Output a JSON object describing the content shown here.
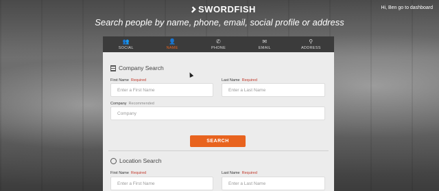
{
  "header": {
    "brand": "SWORDFISH",
    "user_link": "Hi, Ben go to dashboard",
    "headline": "Search people by name, phone, email, social profile or address"
  },
  "tabs": [
    {
      "label": "SOCIAL",
      "icon": "users-icon",
      "glyph": "👥",
      "active": false
    },
    {
      "label": "NAME",
      "icon": "person-icon",
      "glyph": "👤",
      "active": true
    },
    {
      "label": "PHONE",
      "icon": "phone-icon",
      "glyph": "✆",
      "active": false
    },
    {
      "label": "EMAIL",
      "icon": "envelope-icon",
      "glyph": "✉",
      "active": false
    },
    {
      "label": "ADDRESS",
      "icon": "map-pin-icon",
      "glyph": "⚲",
      "active": false
    }
  ],
  "company_search": {
    "title": "Company Search",
    "first_name": {
      "label": "First Name",
      "tag": "Required",
      "placeholder": "Enter a First Name",
      "value": ""
    },
    "last_name": {
      "label": "Last Name",
      "tag": "Required",
      "placeholder": "Enter a Last Name",
      "value": ""
    },
    "company": {
      "label": "Company",
      "tag": "Recommended",
      "placeholder": "Company",
      "value": ""
    },
    "submit_label": "SEARCH"
  },
  "location_search": {
    "title": "Location Search",
    "first_name": {
      "label": "First Name",
      "tag": "Required",
      "placeholder": "Enter a First Name",
      "value": ""
    },
    "last_name": {
      "label": "Last Name",
      "tag": "Required",
      "placeholder": "Enter a Last Name",
      "value": ""
    }
  },
  "colors": {
    "accent": "#e8631e",
    "tab_bar": "#3b3b3b",
    "panel": "#ececec",
    "required": "#c0392b"
  }
}
